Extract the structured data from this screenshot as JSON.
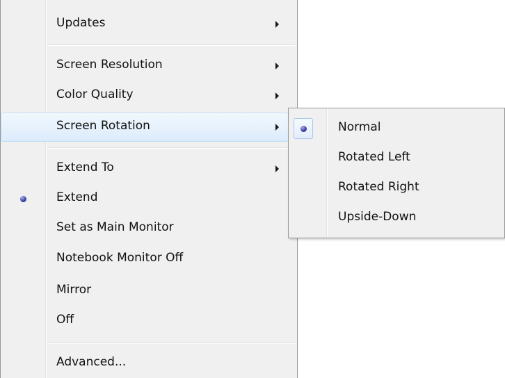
{
  "main_menu": {
    "items": [
      {
        "label": "Updates",
        "has_submenu": true
      },
      {
        "label": "Screen Resolution",
        "has_submenu": true
      },
      {
        "label": "Color Quality",
        "has_submenu": true
      },
      {
        "label": "Screen Rotation",
        "has_submenu": true,
        "highlighted": true
      },
      {
        "label": "Extend To",
        "has_submenu": true
      },
      {
        "label": "Extend",
        "checked": true
      },
      {
        "label": "Set as Main Monitor"
      },
      {
        "label": "Notebook Monitor Off"
      },
      {
        "label": "Mirror"
      },
      {
        "label": "Off"
      },
      {
        "label": "Advanced..."
      }
    ]
  },
  "sub_menu": {
    "items": [
      {
        "label": "Normal",
        "checked": true
      },
      {
        "label": "Rotated Left"
      },
      {
        "label": "Rotated Right"
      },
      {
        "label": "Upside-Down"
      }
    ]
  },
  "colors": {
    "menu_background": "#f0f0f0",
    "highlight": "#dcebfc",
    "radio": "#3c44a8"
  }
}
